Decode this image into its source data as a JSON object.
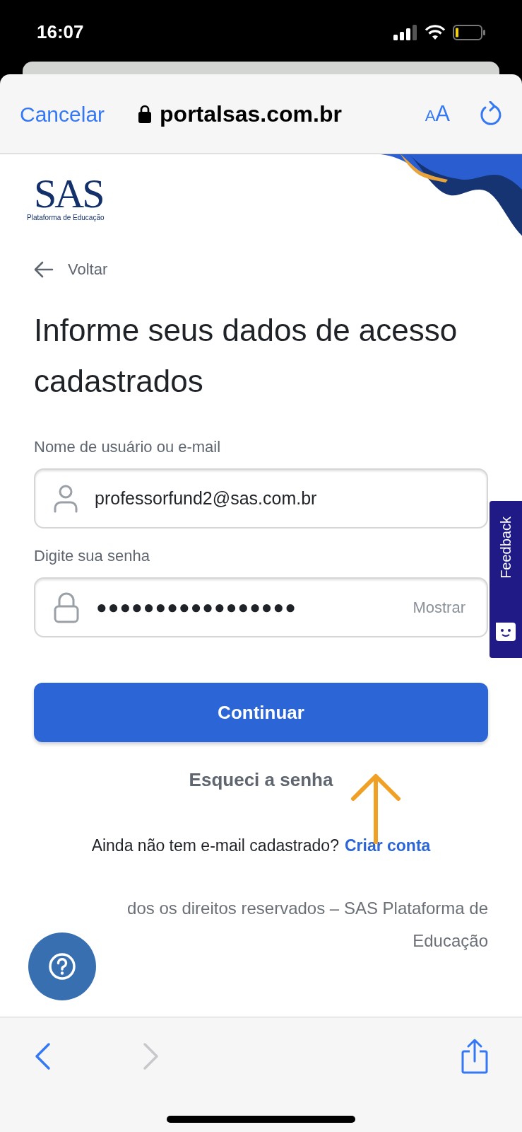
{
  "status_bar": {
    "time": "16:07"
  },
  "browser": {
    "cancel": "Cancelar",
    "url": "portalsas.com.br",
    "text_size": "AA"
  },
  "logo": {
    "wordmark": "SAS",
    "tagline": "Plataforma de Educação"
  },
  "back_link": "Voltar",
  "heading": "Informe seus dados de acesso cadastrados",
  "fields": [
    {
      "kind": "text",
      "label": "Nome de usuário ou e-mail",
      "value": "professorfund2@sas.com.br"
    },
    {
      "kind": "password",
      "label": "Digite sua senha",
      "value": "●●●●●●●●●●●●●●●●●",
      "toggle": "Mostrar"
    }
  ],
  "primary_button": "Continuar",
  "forgot_link": "Esqueci a senha",
  "signup": {
    "prompt": "Ainda não tem e-mail cadastrado?",
    "link": "Criar conta"
  },
  "footer": "dos os direitos reservados – SAS Plataforma de Educação",
  "feedback_tab": "Feedback",
  "toolbar": {
    "back": {
      "disabled": false
    },
    "forward": {
      "disabled": true
    }
  }
}
